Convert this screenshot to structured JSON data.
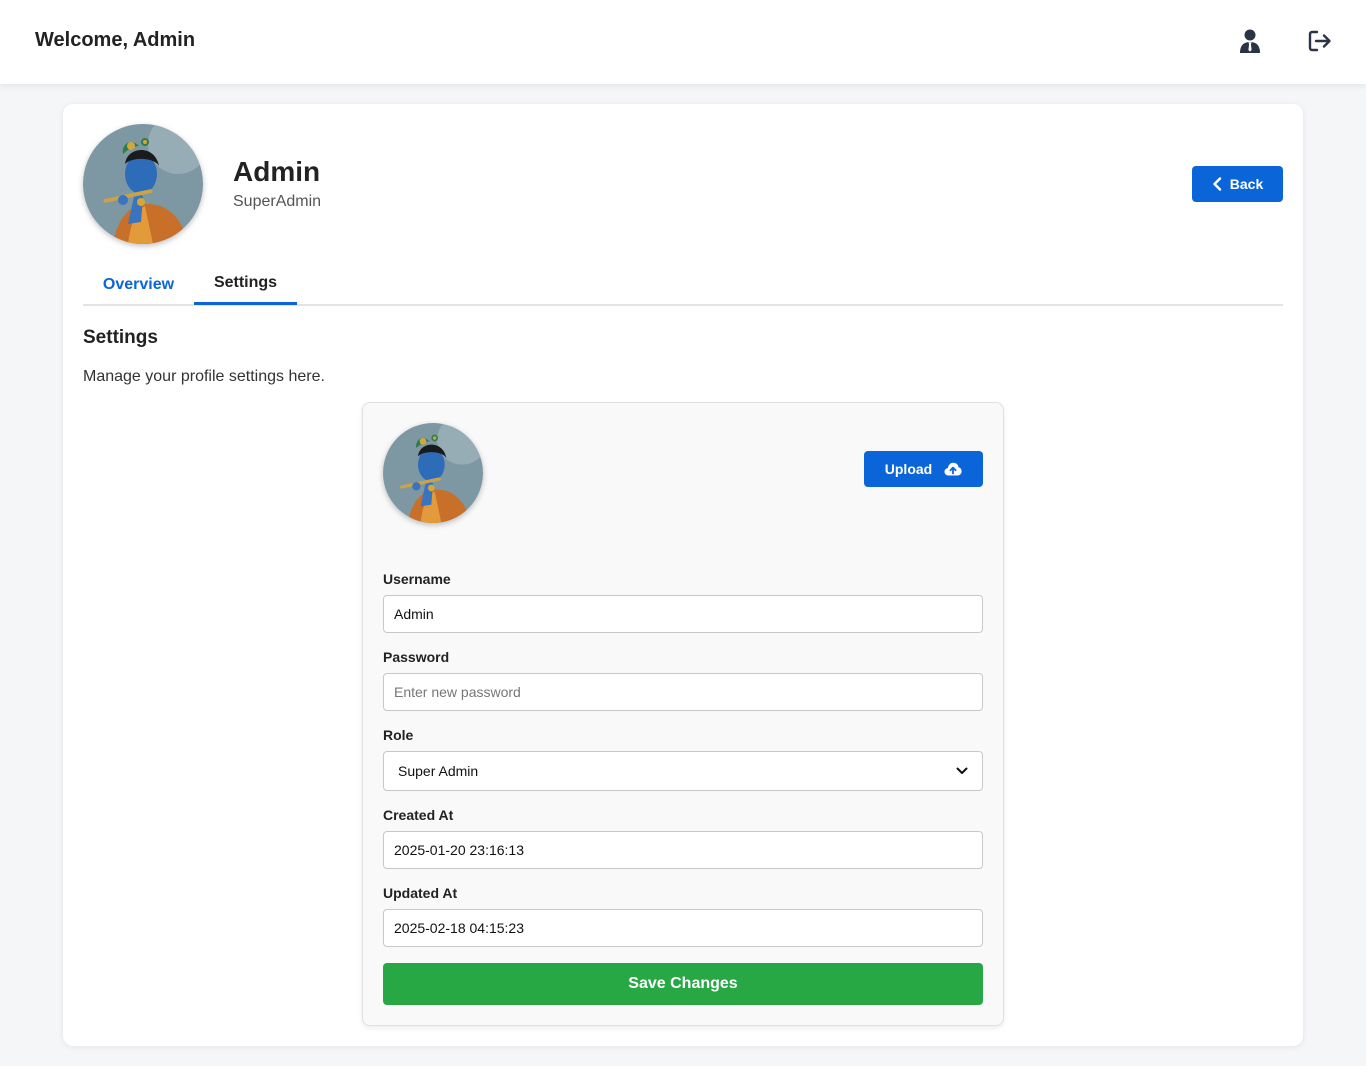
{
  "header": {
    "welcome": "Welcome, Admin",
    "icons": [
      "user-icon",
      "logout-icon"
    ]
  },
  "profile": {
    "name": "Admin",
    "role": "SuperAdmin",
    "back_label": "Back"
  },
  "tabs": [
    {
      "label": "Overview",
      "active": false
    },
    {
      "label": "Settings",
      "active": true
    }
  ],
  "settings": {
    "title": "Settings",
    "description": "Manage your profile settings here.",
    "upload_label": "Upload",
    "fields": {
      "username": {
        "label": "Username",
        "value": "Admin"
      },
      "password": {
        "label": "Password",
        "placeholder": "Enter new password",
        "value": ""
      },
      "role": {
        "label": "Role",
        "value": "Super Admin"
      },
      "created_at": {
        "label": "Created At",
        "value": "2025-01-20 23:16:13"
      },
      "updated_at": {
        "label": "Updated At",
        "value": "2025-02-18 04:15:23"
      }
    },
    "save_label": "Save Changes"
  },
  "colors": {
    "primary": "#0a66d8",
    "success": "#28a745",
    "background": "#f5f6f8"
  }
}
